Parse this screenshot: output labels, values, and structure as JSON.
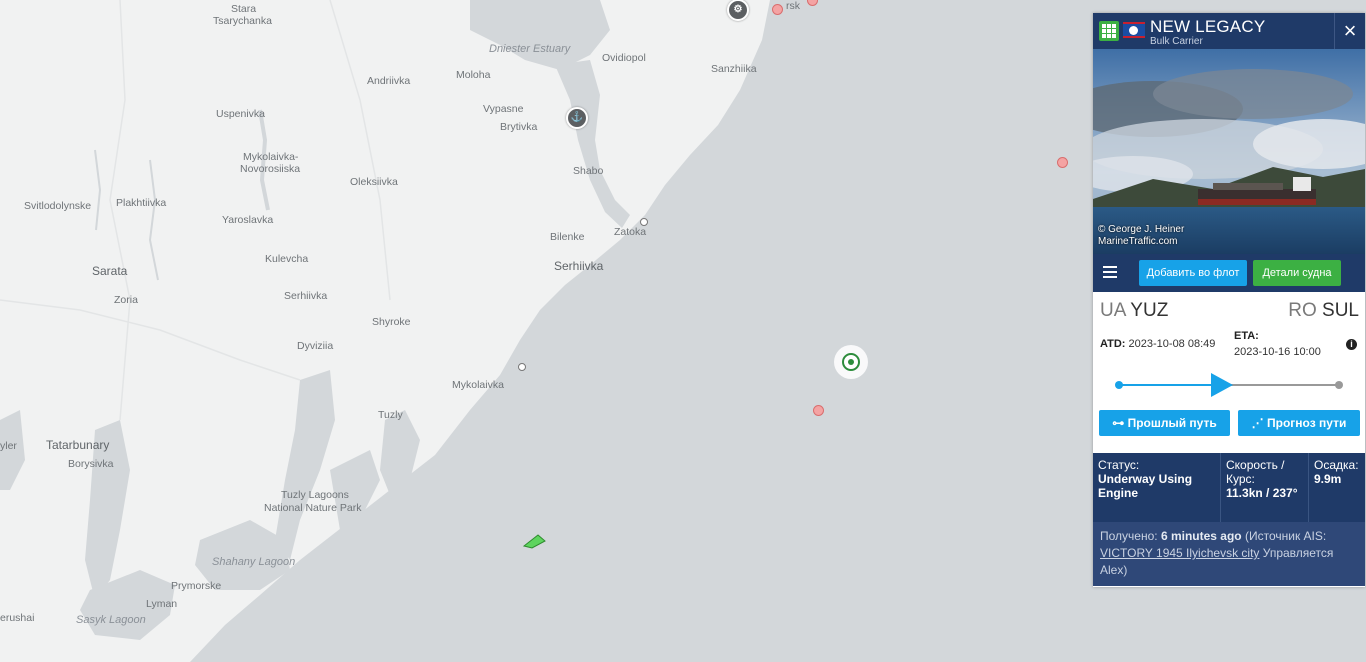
{
  "map": {
    "places": [
      {
        "name": "Stara",
        "cls": "place"
      },
      {
        "name": "Tsarychanka",
        "cls": "place"
      },
      {
        "name": "Andriivka",
        "cls": "place"
      },
      {
        "name": "Moloha",
        "cls": "place"
      },
      {
        "name": "Ovidiopol",
        "cls": "place"
      },
      {
        "name": "Sanzhiika",
        "cls": "place"
      },
      {
        "name": "Uspenivka",
        "cls": "place"
      },
      {
        "name": "Vypasne",
        "cls": "place"
      },
      {
        "name": "Brytivka",
        "cls": "place"
      },
      {
        "name": "Mykolaivka-",
        "cls": "place"
      },
      {
        "name": "Novorosiiska",
        "cls": "place"
      },
      {
        "name": "Shabo",
        "cls": "place"
      },
      {
        "name": "Oleksiivka",
        "cls": "place"
      },
      {
        "name": "Svitlodolynske",
        "cls": "place"
      },
      {
        "name": "Plakhtiivka",
        "cls": "place"
      },
      {
        "name": "Yaroslavka",
        "cls": "place"
      },
      {
        "name": "Zatoka",
        "cls": "place"
      },
      {
        "name": "Bilenke",
        "cls": "place"
      },
      {
        "name": "Serhiivka",
        "cls": "place big"
      },
      {
        "name": "Kulevcha",
        "cls": "place"
      },
      {
        "name": "Sarata",
        "cls": "place big"
      },
      {
        "name": "Zoria",
        "cls": "place"
      },
      {
        "name": "Serhiivka",
        "cls": "place"
      },
      {
        "name": "Shyroke",
        "cls": "place"
      },
      {
        "name": "Dyviziia",
        "cls": "place"
      },
      {
        "name": "Mykolaivka",
        "cls": "place"
      },
      {
        "name": "Tuzly",
        "cls": "place"
      },
      {
        "name": "yler",
        "cls": "place"
      },
      {
        "name": "Tatarbunary",
        "cls": "place big"
      },
      {
        "name": "Borysivka",
        "cls": "place"
      },
      {
        "name": "Tuzly Lagoons",
        "cls": "place"
      },
      {
        "name": "National Nature Park",
        "cls": "place"
      },
      {
        "name": "Prymorske",
        "cls": "place"
      },
      {
        "name": "Lyman",
        "cls": "place"
      },
      {
        "name": "erushai",
        "cls": "place"
      },
      {
        "name": "rsk",
        "cls": "place"
      }
    ],
    "water_labels": [
      "Dniester Estuary",
      "Shahany Lagoon",
      "Sasyk Lagoon"
    ]
  },
  "vessel": {
    "name": "NEW LEGACY",
    "type": "Bulk Carrier",
    "photo_credit_1": "© George J. Heiner",
    "photo_credit_2": "MarineTraffic.com",
    "add_fleet_label": "Добавить во флот",
    "details_label": "Детали судна",
    "from_country": "UA",
    "from_port": "YUZ",
    "to_country": "RO",
    "to_port": "SUL",
    "atd_label": "ATD:",
    "atd_value": "2023-10-08 08:49",
    "eta_label": "ETA:",
    "eta_value": "2023-10-16 10:00",
    "progress": 0.5,
    "past_track_label": "Прошлый путь",
    "forecast_label": "Прогноз пути",
    "status_label": "Статус:",
    "status_value": "Underway Using Engine",
    "speed_label": "Скорость / Курс:",
    "speed_value": "11.3kn / 237°",
    "draught_label": "Осадка:",
    "draught_value": "9.9m",
    "received_prefix": "Получено:",
    "received_time": "6 minutes ago",
    "source_prefix": "(Источник AIS:",
    "source_link": "VICTORY 1945 Ilyichevsk city",
    "managed_text": "Управляется Alex)"
  },
  "colors": {
    "header": "#1f3a68",
    "accent_blue": "#17a2e8",
    "accent_green": "#3cb043"
  }
}
